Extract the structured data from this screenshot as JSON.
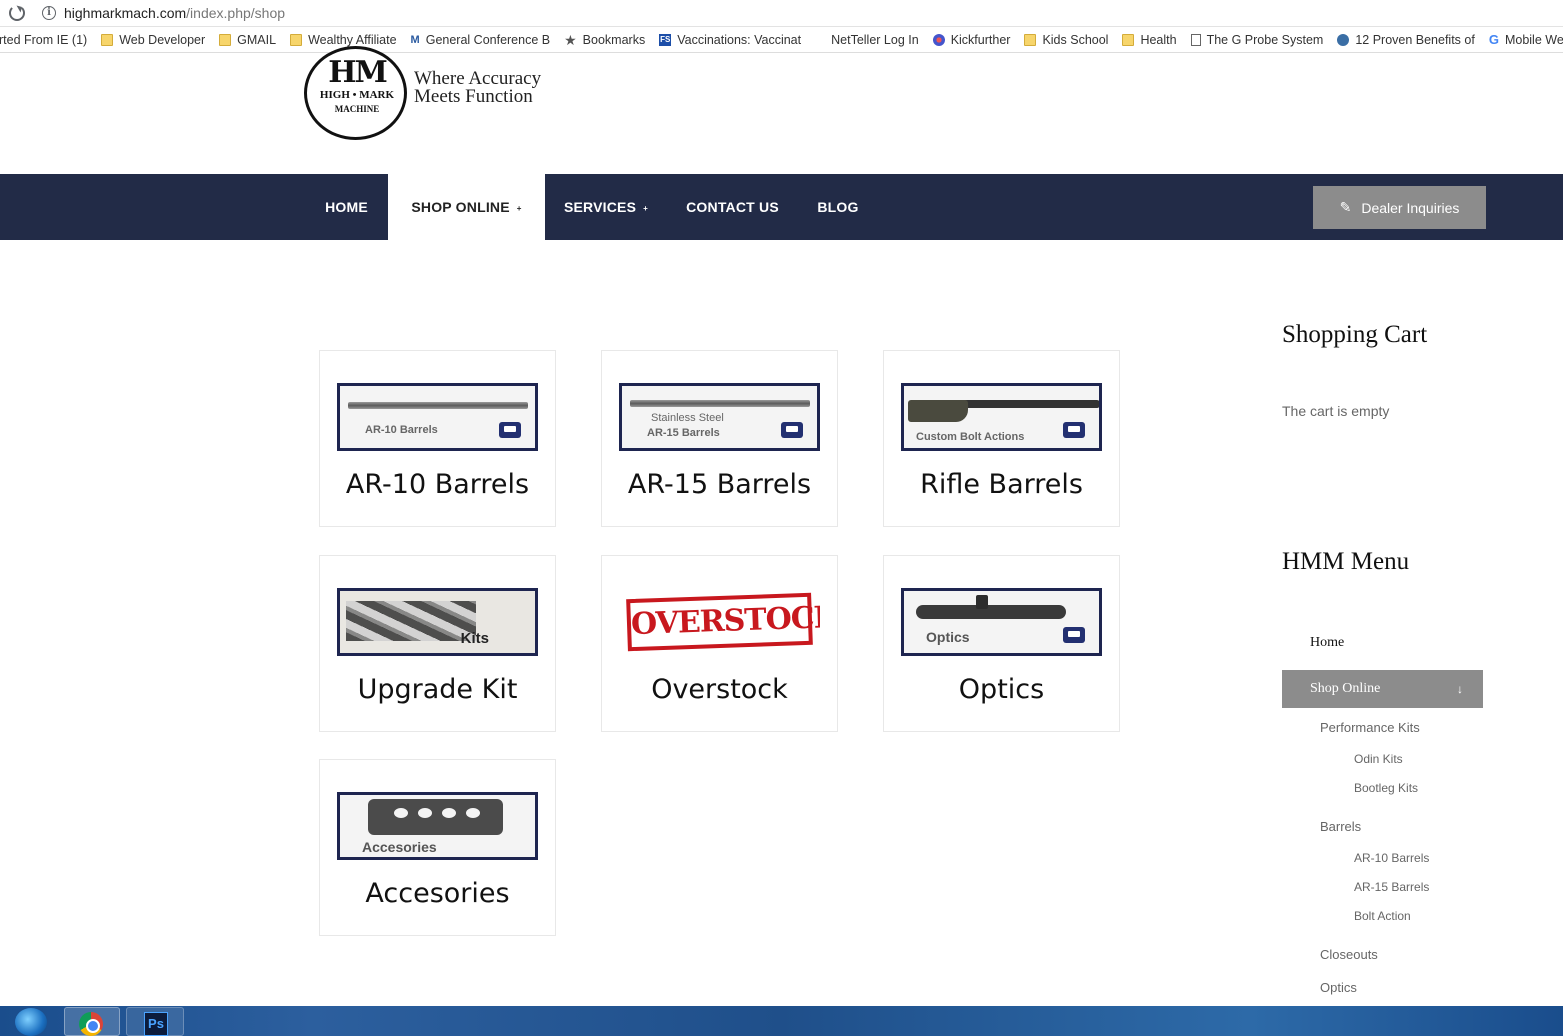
{
  "browser": {
    "url_host": "highmarkmach.com",
    "url_path": "/index.php/shop",
    "bookmarks": [
      {
        "label": "rted From IE (1)",
        "icon": "none"
      },
      {
        "label": "Web Developer",
        "icon": "folder-icon"
      },
      {
        "label": "GMAIL",
        "icon": "folder-icon"
      },
      {
        "label": "Wealthy Affiliate",
        "icon": "folder-icon"
      },
      {
        "label": "General Conference B",
        "icon": "m-icon"
      },
      {
        "label": "Bookmarks",
        "icon": "star-icon"
      },
      {
        "label": "Vaccinations: Vaccinat",
        "icon": "fs-icon"
      },
      {
        "label": "NetTeller Log In",
        "icon": "none"
      },
      {
        "label": "Kickfurther",
        "icon": "kickfurther-icon"
      },
      {
        "label": "Kids School",
        "icon": "folder-icon"
      },
      {
        "label": "Health",
        "icon": "folder-icon"
      },
      {
        "label": "The G Probe System",
        "icon": "document-icon"
      },
      {
        "label": "12 Proven Benefits of",
        "icon": "globe-icon"
      },
      {
        "label": "Mobile Website S",
        "icon": "google-icon"
      }
    ]
  },
  "site": {
    "logo_text": "HM",
    "logo_sub": "HIGH • MARK",
    "logo_sub2": "MACHINE",
    "tagline_line1": "Where Accuracy",
    "tagline_line2": "Meets Function"
  },
  "nav": {
    "home": "HOME",
    "shop": "SHOP ONLINE",
    "services": "SERVICES",
    "contact": "CONTACT US",
    "blog": "BLOG",
    "caret": "+",
    "dealer": "Dealer Inquiries",
    "dealer_icon": "✎"
  },
  "products": [
    {
      "name": "AR-10 Barrels",
      "image_label": "AR-10 Barrels"
    },
    {
      "name": "AR-15 Barrels",
      "image_label_line1": "Stainless Steel",
      "image_label_line2": "AR-15  Barrels"
    },
    {
      "name": "Rifle Barrels",
      "image_label": "Custom Bolt Actions"
    },
    {
      "name": "Upgrade Kit",
      "image_label": "Kits"
    },
    {
      "name": "Overstock",
      "image_label": "OVERSTOCK"
    },
    {
      "name": "Optics",
      "image_label": "Optics"
    },
    {
      "name": "Accesories",
      "image_label": "Accesories"
    }
  ],
  "sidebar": {
    "cart_title": "Shopping Cart",
    "cart_status": "The cart is empty",
    "menu_title": "HMM Menu",
    "menu_home": "Home",
    "menu_active": "Shop Online",
    "menu_active_arrow": "↓",
    "submenu": [
      {
        "label": "Performance Kits",
        "level": 1
      },
      {
        "label": "Odin Kits",
        "level": 2
      },
      {
        "label": "Bootleg Kits",
        "level": 2
      },
      {
        "label": "Barrels",
        "level": 1
      },
      {
        "label": "AR-10 Barrels",
        "level": 2
      },
      {
        "label": "AR-15 Barrels",
        "level": 2
      },
      {
        "label": "Bolt Action",
        "level": 2
      },
      {
        "label": "Closeouts",
        "level": 1
      },
      {
        "label": "Optics",
        "level": 1
      }
    ]
  },
  "taskbar": {
    "ps_label": "Ps"
  },
  "colors": {
    "nav_bg": "#222b47",
    "dealer_btn": "#8c8c8c",
    "tile_border": "#1e2550",
    "overstock_red": "#c8181e"
  }
}
